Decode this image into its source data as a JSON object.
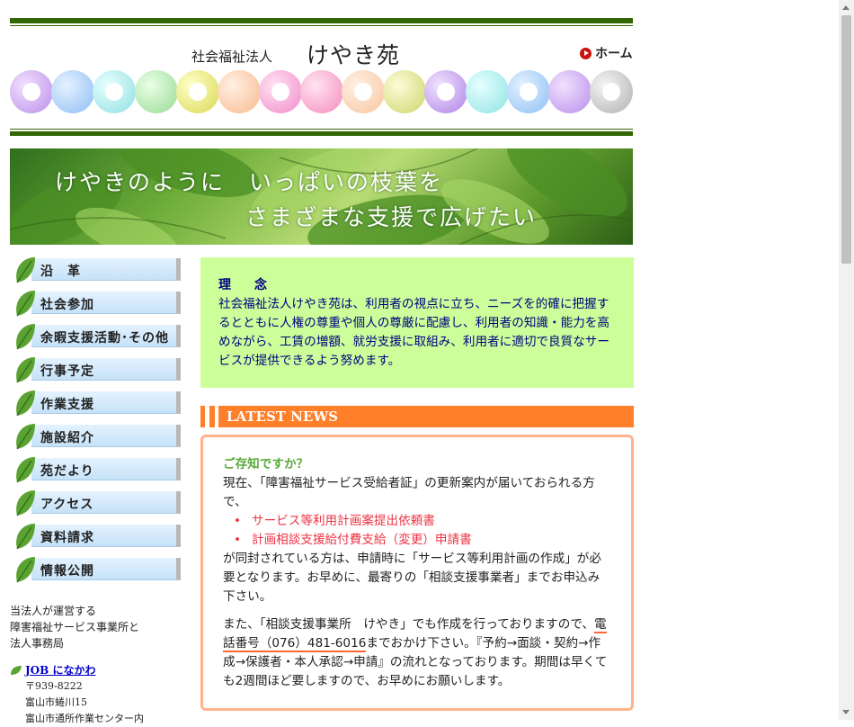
{
  "header": {
    "org_label": "社会福祉法人",
    "org_name": "けやき苑",
    "home_label": "ホーム"
  },
  "banner": {
    "line1": "けやきのように　いっぱいの枝葉を",
    "line2": "さまざまな支援で広げたい"
  },
  "colors": {
    "rule": "#336600",
    "nav_bar": "#cde6fb",
    "philosophy_bg": "#ccff99",
    "news_accent": "#ff7f2a",
    "news_list": "#ee3344"
  },
  "nav": {
    "items": [
      {
        "label": "沿　革"
      },
      {
        "label": "社会参加"
      },
      {
        "label": "余暇支援活動･その他"
      },
      {
        "label": "行事予定"
      },
      {
        "label": "作業支援"
      },
      {
        "label": "施設紹介"
      },
      {
        "label": "苑だより"
      },
      {
        "label": "アクセス"
      },
      {
        "label": "資料請求"
      },
      {
        "label": "情報公開"
      }
    ]
  },
  "sidebar": {
    "info_line1": "当法人が運営する",
    "info_line2": "障害福祉サービス事業所と",
    "info_line3": "法人事務局",
    "job_link": "JOB になかわ",
    "postal": "〒939-8222",
    "address1": "富山市蜷川15",
    "address2": "富山市通所作業センター内"
  },
  "philosophy": {
    "title": "理　念",
    "text": "社会福祉法人けやき苑は、利用者の視点に立ち、ニーズを的確に把握するとともに人権の尊重や個人の尊厳に配慮し、利用者の知識・能力を高めながら、工賃の増額、就労支援に取組み、利用者に適切で良質なサービスが提供できるよう努めます。"
  },
  "news": {
    "heading": "LATEST NEWS",
    "question": "ご存知ですか？",
    "intro": "現在、「障害福祉サービス受給者証」の更新案内が届いておられる方で、",
    "items": [
      "サービス等利用計画案提出依頼書",
      "計画相談支援給付費支給（変更）申請書"
    ],
    "after_list": "が同封されている方は、申請時に「サービス等利用計画の作成」が必要となります。お早めに、最寄りの「相談支援事業者」までお申込み下さい。",
    "para2_start": "また、「相談支援事業所　けやき」でも作成を行っておりますので、",
    "phone": "電話番号（076）481-6016",
    "para2_end": "までおかけ下さい。『予約→面談・契約→作成→保護者・本人承認→申請』の流れとなっております。期間は早くても2週間ほど要しますので、お早めにお願いします。"
  }
}
